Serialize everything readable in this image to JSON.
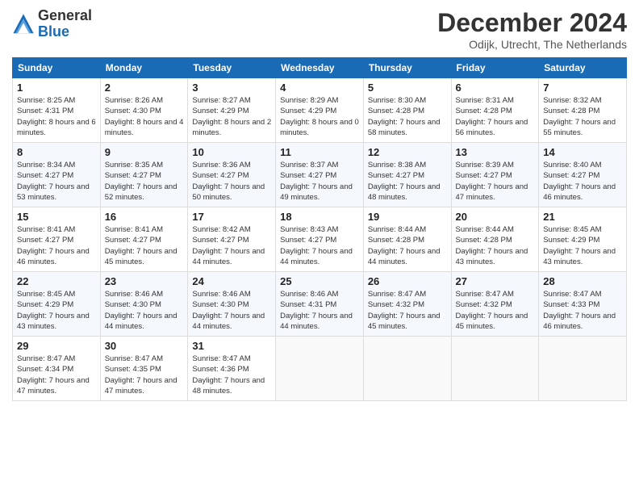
{
  "header": {
    "logo_general": "General",
    "logo_blue": "Blue",
    "title": "December 2024",
    "location": "Odijk, Utrecht, The Netherlands"
  },
  "days_of_week": [
    "Sunday",
    "Monday",
    "Tuesday",
    "Wednesday",
    "Thursday",
    "Friday",
    "Saturday"
  ],
  "weeks": [
    [
      {
        "day": "1",
        "sunrise": "8:25 AM",
        "sunset": "4:31 PM",
        "daylight": "8 hours and 6 minutes."
      },
      {
        "day": "2",
        "sunrise": "8:26 AM",
        "sunset": "4:30 PM",
        "daylight": "8 hours and 4 minutes."
      },
      {
        "day": "3",
        "sunrise": "8:27 AM",
        "sunset": "4:29 PM",
        "daylight": "8 hours and 2 minutes."
      },
      {
        "day": "4",
        "sunrise": "8:29 AM",
        "sunset": "4:29 PM",
        "daylight": "8 hours and 0 minutes."
      },
      {
        "day": "5",
        "sunrise": "8:30 AM",
        "sunset": "4:28 PM",
        "daylight": "7 hours and 58 minutes."
      },
      {
        "day": "6",
        "sunrise": "8:31 AM",
        "sunset": "4:28 PM",
        "daylight": "7 hours and 56 minutes."
      },
      {
        "day": "7",
        "sunrise": "8:32 AM",
        "sunset": "4:28 PM",
        "daylight": "7 hours and 55 minutes."
      }
    ],
    [
      {
        "day": "8",
        "sunrise": "8:34 AM",
        "sunset": "4:27 PM",
        "daylight": "7 hours and 53 minutes."
      },
      {
        "day": "9",
        "sunrise": "8:35 AM",
        "sunset": "4:27 PM",
        "daylight": "7 hours and 52 minutes."
      },
      {
        "day": "10",
        "sunrise": "8:36 AM",
        "sunset": "4:27 PM",
        "daylight": "7 hours and 50 minutes."
      },
      {
        "day": "11",
        "sunrise": "8:37 AM",
        "sunset": "4:27 PM",
        "daylight": "7 hours and 49 minutes."
      },
      {
        "day": "12",
        "sunrise": "8:38 AM",
        "sunset": "4:27 PM",
        "daylight": "7 hours and 48 minutes."
      },
      {
        "day": "13",
        "sunrise": "8:39 AM",
        "sunset": "4:27 PM",
        "daylight": "7 hours and 47 minutes."
      },
      {
        "day": "14",
        "sunrise": "8:40 AM",
        "sunset": "4:27 PM",
        "daylight": "7 hours and 46 minutes."
      }
    ],
    [
      {
        "day": "15",
        "sunrise": "8:41 AM",
        "sunset": "4:27 PM",
        "daylight": "7 hours and 46 minutes."
      },
      {
        "day": "16",
        "sunrise": "8:41 AM",
        "sunset": "4:27 PM",
        "daylight": "7 hours and 45 minutes."
      },
      {
        "day": "17",
        "sunrise": "8:42 AM",
        "sunset": "4:27 PM",
        "daylight": "7 hours and 44 minutes."
      },
      {
        "day": "18",
        "sunrise": "8:43 AM",
        "sunset": "4:27 PM",
        "daylight": "7 hours and 44 minutes."
      },
      {
        "day": "19",
        "sunrise": "8:44 AM",
        "sunset": "4:28 PM",
        "daylight": "7 hours and 44 minutes."
      },
      {
        "day": "20",
        "sunrise": "8:44 AM",
        "sunset": "4:28 PM",
        "daylight": "7 hours and 43 minutes."
      },
      {
        "day": "21",
        "sunrise": "8:45 AM",
        "sunset": "4:29 PM",
        "daylight": "7 hours and 43 minutes."
      }
    ],
    [
      {
        "day": "22",
        "sunrise": "8:45 AM",
        "sunset": "4:29 PM",
        "daylight": "7 hours and 43 minutes."
      },
      {
        "day": "23",
        "sunrise": "8:46 AM",
        "sunset": "4:30 PM",
        "daylight": "7 hours and 44 minutes."
      },
      {
        "day": "24",
        "sunrise": "8:46 AM",
        "sunset": "4:30 PM",
        "daylight": "7 hours and 44 minutes."
      },
      {
        "day": "25",
        "sunrise": "8:46 AM",
        "sunset": "4:31 PM",
        "daylight": "7 hours and 44 minutes."
      },
      {
        "day": "26",
        "sunrise": "8:47 AM",
        "sunset": "4:32 PM",
        "daylight": "7 hours and 45 minutes."
      },
      {
        "day": "27",
        "sunrise": "8:47 AM",
        "sunset": "4:32 PM",
        "daylight": "7 hours and 45 minutes."
      },
      {
        "day": "28",
        "sunrise": "8:47 AM",
        "sunset": "4:33 PM",
        "daylight": "7 hours and 46 minutes."
      }
    ],
    [
      {
        "day": "29",
        "sunrise": "8:47 AM",
        "sunset": "4:34 PM",
        "daylight": "7 hours and 47 minutes."
      },
      {
        "day": "30",
        "sunrise": "8:47 AM",
        "sunset": "4:35 PM",
        "daylight": "7 hours and 47 minutes."
      },
      {
        "day": "31",
        "sunrise": "8:47 AM",
        "sunset": "4:36 PM",
        "daylight": "7 hours and 48 minutes."
      },
      null,
      null,
      null,
      null
    ]
  ]
}
